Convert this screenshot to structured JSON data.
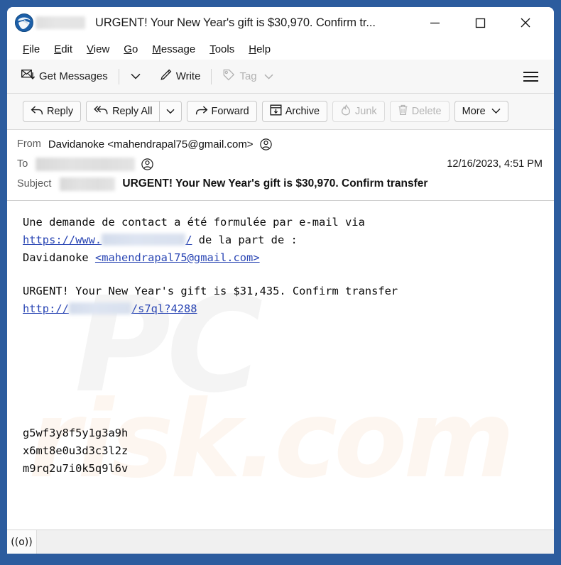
{
  "window": {
    "title": "URGENT! Your New Year's gift is $30,970. Confirm tr...",
    "app_icon": "thunderbird-icon",
    "minimize_label": "–",
    "maximize_label": "□",
    "close_label": "✕",
    "frame_color": "#2c5c9e"
  },
  "menubar": {
    "items": [
      {
        "accesskey": "F",
        "rest": "ile"
      },
      {
        "accesskey": "E",
        "rest": "dit"
      },
      {
        "accesskey": "V",
        "rest": "iew"
      },
      {
        "accesskey": "G",
        "rest": "o"
      },
      {
        "accesskey": "M",
        "rest": "essage"
      },
      {
        "accesskey": "T",
        "rest": "ools"
      },
      {
        "accesskey": "H",
        "rest": "elp"
      }
    ]
  },
  "toolbar": {
    "get_messages_label": "Get Messages",
    "get_messages_caret": "∨",
    "write_label": "Write",
    "tag_label": "Tag",
    "tag_caret": "∨",
    "app_menu_label": "hamburger-menu"
  },
  "actionbar": {
    "reply_label": "Reply",
    "reply_all_label": "Reply All",
    "reply_all_caret": "∨",
    "forward_label": "Forward",
    "archive_label": "Archive",
    "junk_label": "Junk",
    "delete_label": "Delete",
    "more_label": "More",
    "more_caret": "∨"
  },
  "headers": {
    "from_label": "From",
    "from_value": "Davidanoke <mahendrapal75@gmail.com>",
    "to_label": "To",
    "to_value_redacted": true,
    "subject_label": "Subject",
    "subject_value": "URGENT! Your New Year's gift is $30,970. Confirm transfer",
    "date": "12/16/2023, 4:51 PM"
  },
  "body": {
    "p1_line1": "Une demande de contact a été formulée par e-mail via",
    "p1_link_prefix": "https://www.",
    "p1_link_suffix": "/",
    "p1_line2_tail": " de la part de :",
    "p1_line3_name": "Davidanoke ",
    "p1_line3_link": "<mahendrapal75@gmail.com>",
    "p2_line1": "URGENT! Your New Year's gift is $31,435. Confirm transfer",
    "p2_link_prefix": "http://",
    "p2_link_suffix": "/s7ql?4288",
    "codes": [
      "g5wf3y8f5y1g3a9h",
      "x6mt8e0u3d3c3l2z",
      "m9rq2u7i0k5q9l6v"
    ],
    "watermark_top": "PC",
    "watermark_bottom": "risk.com",
    "link_color": "#2a46b4"
  },
  "statusbar": {
    "icon": "broadcast-icon",
    "icon_glyph": "((o))"
  }
}
